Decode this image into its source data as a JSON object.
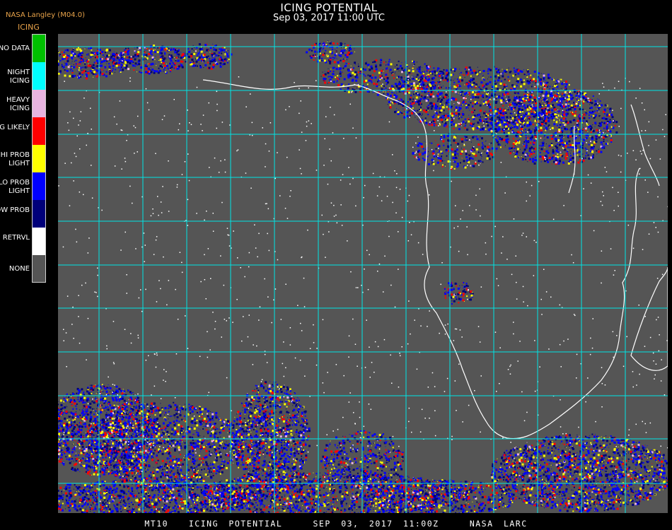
{
  "header": {
    "credit": "NASA Langley (M04.0)",
    "product": "ICING",
    "title": "ICING POTENTIAL",
    "datetime": "Sep 03, 2017 11:00 UTC"
  },
  "legend": {
    "items": [
      {
        "label": "NO DATA",
        "color": "#00c000"
      },
      {
        "label": "NIGHT ICING",
        "color": "#00ffff"
      },
      {
        "label": "HEAVY ICING",
        "color": "#e8b4e0"
      },
      {
        "label": "MOG LIKELY",
        "color": "#ff0000"
      },
      {
        "label": "HI PROB LIGHT",
        "color": "#ffff00"
      },
      {
        "label": "LO PROB LIGHT",
        "color": "#0000ff"
      },
      {
        "label": "LOW PROB",
        "color": "#00007a"
      },
      {
        "label": "NO RETRVL",
        "color": "#ffffff"
      },
      {
        "label": "NONE",
        "color": "#555555"
      }
    ]
  },
  "map": {
    "background_color": "#555555",
    "grid_color": "#00e5e5",
    "coast_color": "#ffffff",
    "region": "Southern Africa and South Atlantic"
  },
  "footer": {
    "text": "MT10  ICING POTENTIAL   SEP 03, 2017 11:00Z   NASA LARC"
  }
}
